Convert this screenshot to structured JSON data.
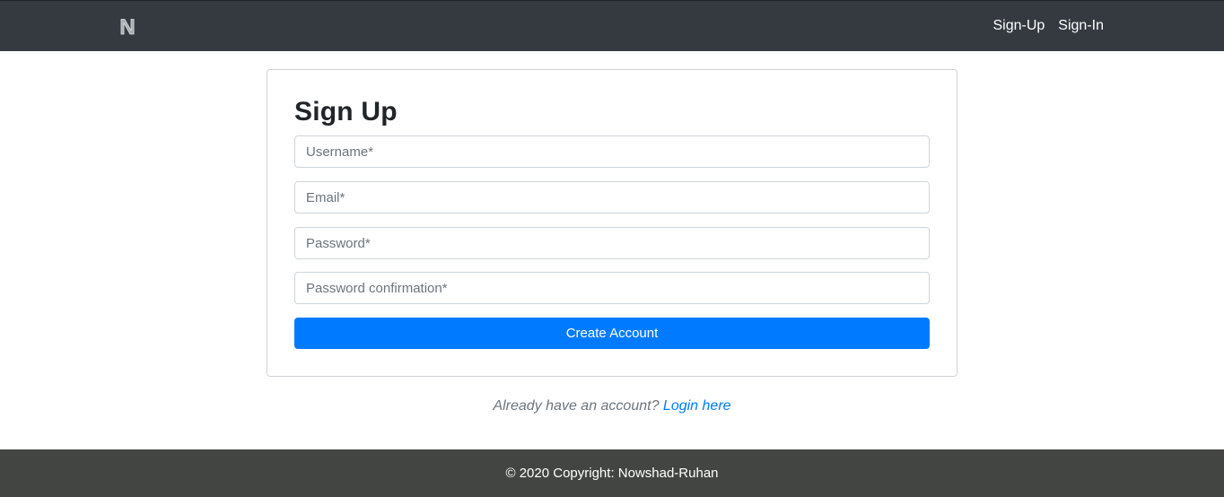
{
  "navbar": {
    "logo": "N",
    "links": [
      "Sign-Up",
      "Sign-In"
    ]
  },
  "form": {
    "title": "Sign Up",
    "fields": [
      {
        "placeholder": "Username*",
        "value": ""
      },
      {
        "placeholder": "Email*",
        "value": ""
      },
      {
        "placeholder": "Password*",
        "value": ""
      },
      {
        "placeholder": "Password confirmation*",
        "value": ""
      }
    ],
    "submit_label": "Create Account"
  },
  "login_hint": {
    "text": "Already have an account?",
    "link": "Login here"
  },
  "footer": {
    "text": "© 2020 Copyright: Nowshad-Ruhan"
  },
  "colors": {
    "navbar_bg": "#343a40",
    "footer_bg": "#434543",
    "accent": "#007bff"
  }
}
